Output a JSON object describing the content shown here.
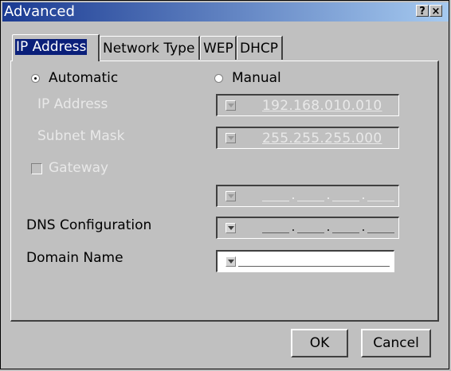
{
  "window": {
    "title": "Advanced",
    "help_label": "?",
    "close_label": "×"
  },
  "tabs": [
    {
      "label": "IP Address",
      "active": true
    },
    {
      "label": "Network Type"
    },
    {
      "label": "WEP"
    },
    {
      "label": "DHCP"
    }
  ],
  "mode": {
    "automatic_label": "Automatic",
    "manual_label": "Manual",
    "selected": "Automatic"
  },
  "ip_address": {
    "label": "IP Address",
    "value": "192.168.010.010"
  },
  "subnet_mask": {
    "label": "Subnet Mask",
    "value": "255.255.255.000"
  },
  "gateway": {
    "label": "Gateway",
    "checked": false
  },
  "dns": {
    "label": "DNS Configuration"
  },
  "domain": {
    "label": "Domain Name"
  },
  "buttons": {
    "ok": "OK",
    "cancel": "Cancel"
  },
  "colors": {
    "titlebar_start": "#1a3a92",
    "titlebar_end": "#a6caf0",
    "face": "#c0c0c0",
    "selected_tab": "#0a1f7a"
  }
}
